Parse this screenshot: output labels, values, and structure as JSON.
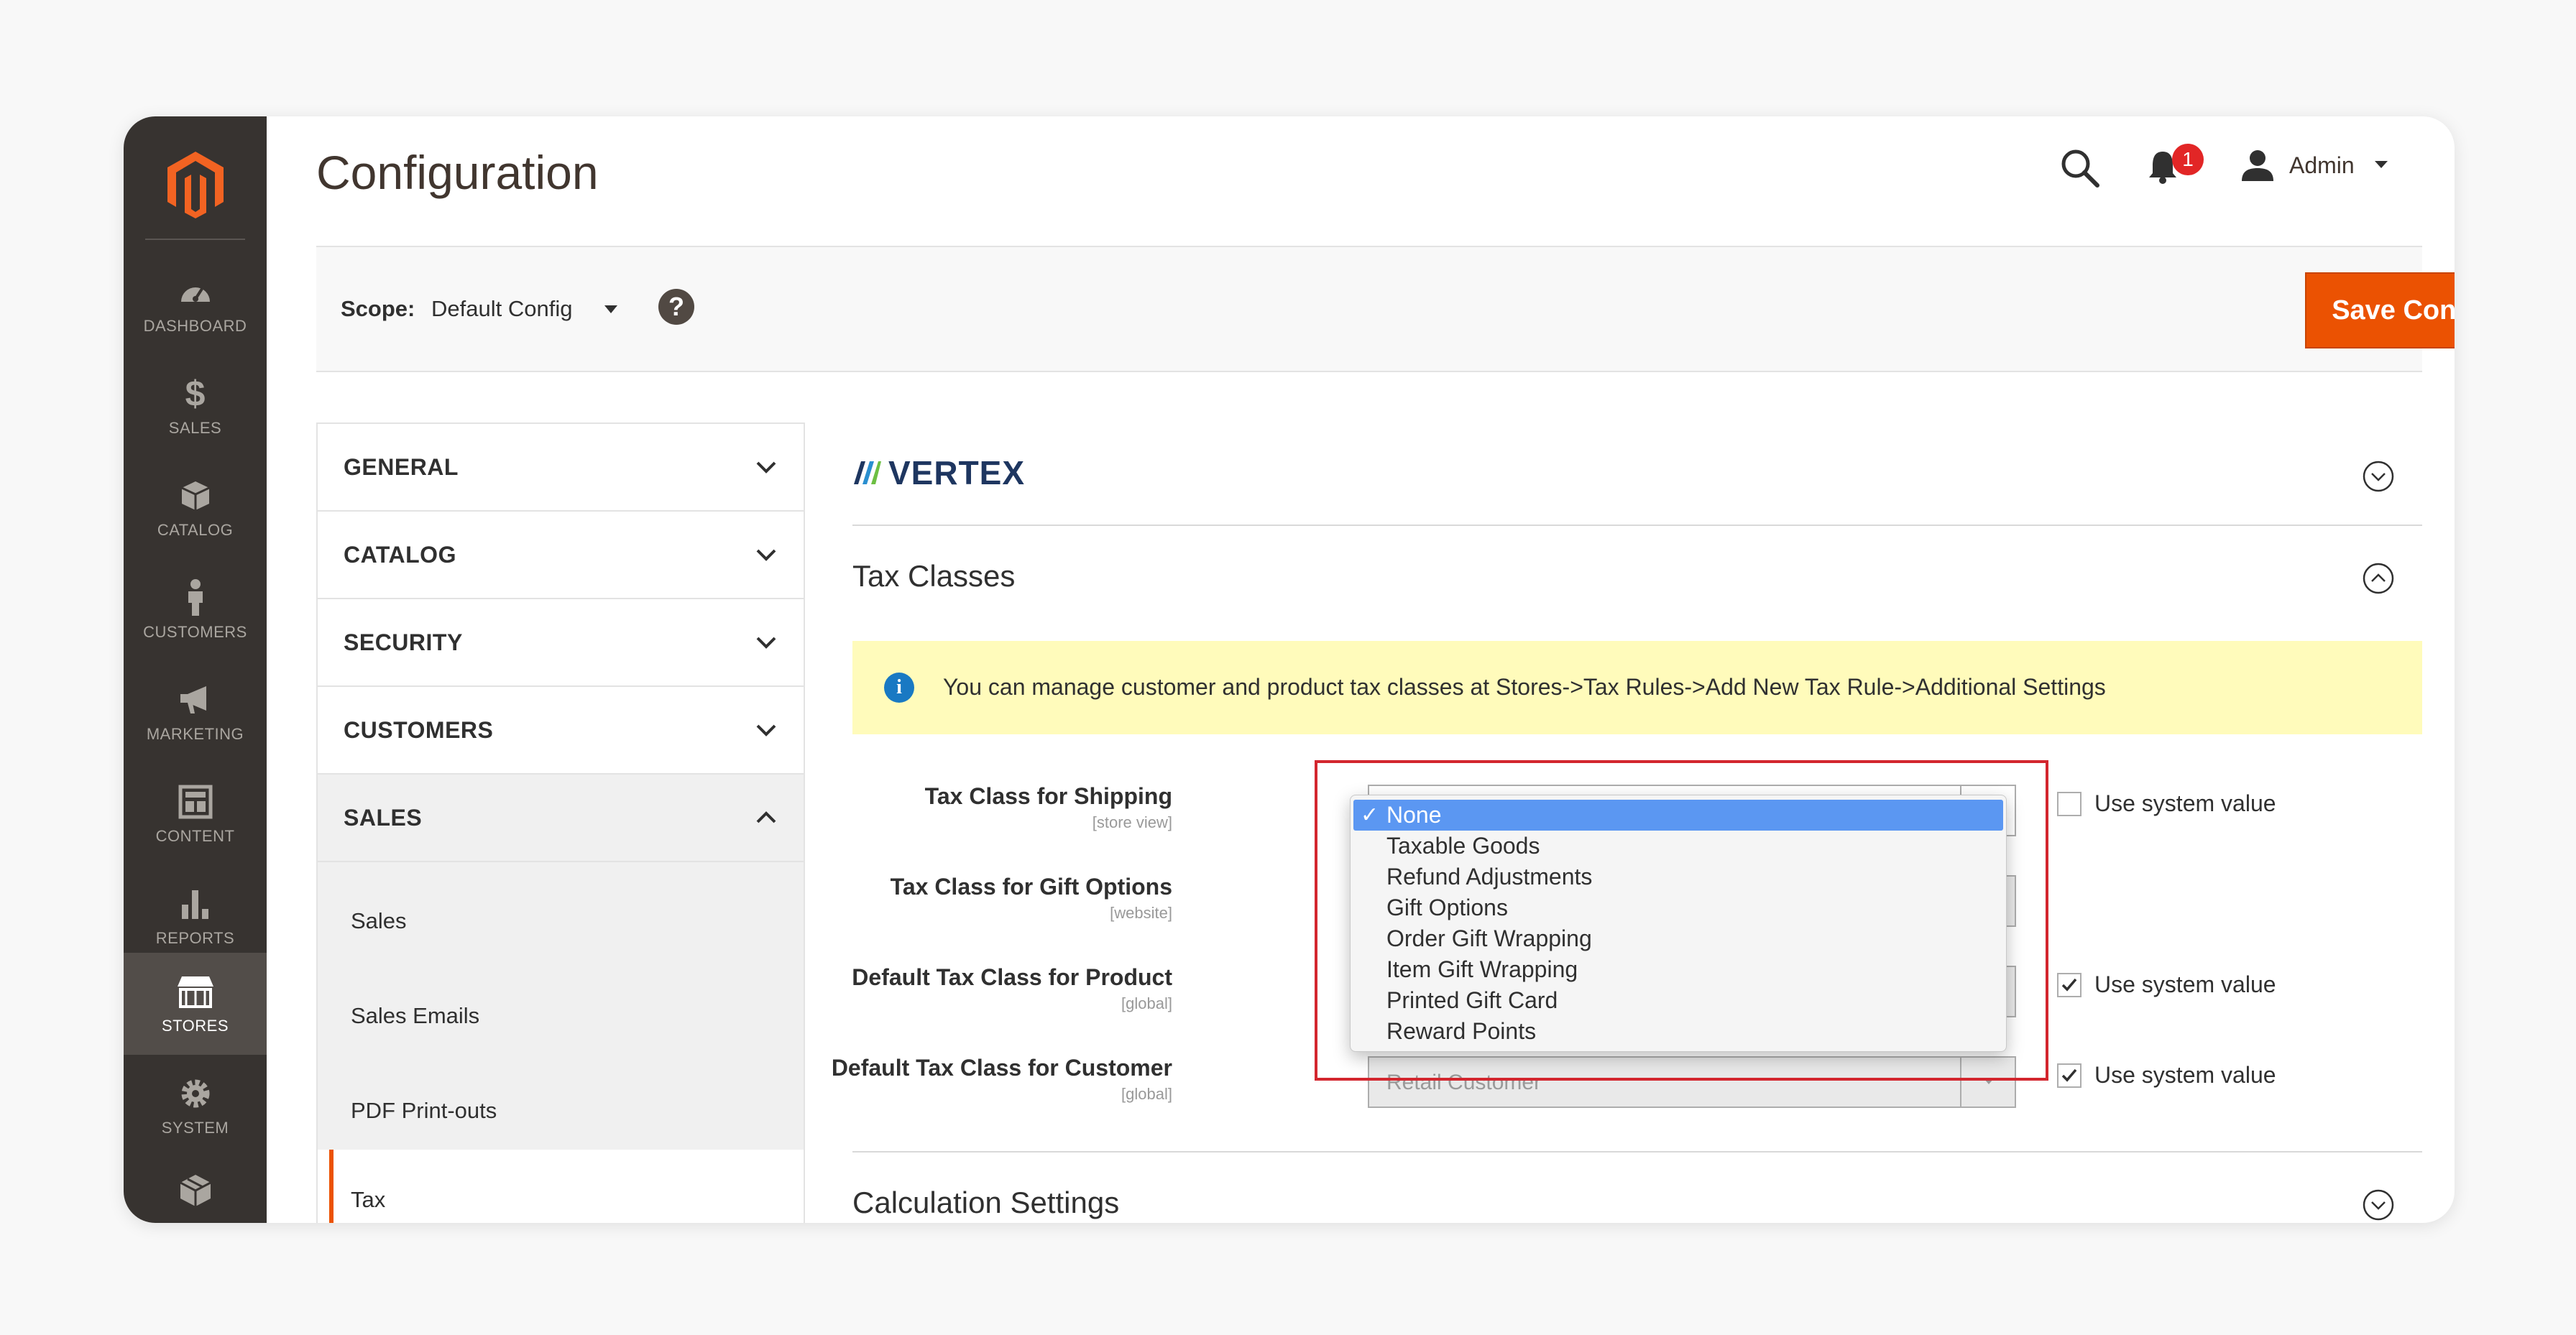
{
  "sidebar": {
    "items": [
      {
        "label": "DASHBOARD",
        "icon": "dashboard-icon"
      },
      {
        "label": "SALES",
        "icon": "dollar-icon"
      },
      {
        "label": "CATALOG",
        "icon": "box-icon"
      },
      {
        "label": "CUSTOMERS",
        "icon": "person-icon"
      },
      {
        "label": "MARKETING",
        "icon": "megaphone-icon"
      },
      {
        "label": "CONTENT",
        "icon": "layout-icon"
      },
      {
        "label": "REPORTS",
        "icon": "bar-chart-icon"
      },
      {
        "label": "STORES",
        "icon": "store-icon"
      },
      {
        "label": "SYSTEM",
        "icon": "gear-icon"
      }
    ]
  },
  "header": {
    "title": "Configuration",
    "notification_count": "1",
    "user_name": "Admin"
  },
  "scope": {
    "label": "Scope:",
    "value": "Default Config",
    "help": "?",
    "save_label": "Save Config"
  },
  "config_nav": {
    "sections": [
      {
        "label": "GENERAL"
      },
      {
        "label": "CATALOG"
      },
      {
        "label": "SECURITY"
      },
      {
        "label": "CUSTOMERS"
      },
      {
        "label": "SALES"
      }
    ],
    "sales_sub": [
      "Sales",
      "Sales Emails",
      "PDF Print-outs",
      "Tax"
    ]
  },
  "main": {
    "vertex_label": "VERTEX",
    "tax_classes_title": "Tax Classes",
    "notice": "You can manage customer and product tax classes at Stores->Tax Rules->Add New Tax Rule->Additional Settings",
    "fields": [
      {
        "label": "Tax Class for Shipping",
        "scope": "[store view]"
      },
      {
        "label": "Tax Class for Gift Options",
        "scope": "[website]"
      },
      {
        "label": "Default Tax Class for Product",
        "scope": "[global]"
      },
      {
        "label": "Default Tax Class for Customer",
        "scope": "[global]",
        "value": "Retail Customer"
      }
    ],
    "use_system_value": "Use system value",
    "calculation_title": "Calculation Settings"
  },
  "dropdown": {
    "options": [
      "None",
      "Taxable Goods",
      "Refund Adjustments",
      "Gift Options",
      "Order Gift Wrapping",
      "Item Gift Wrapping",
      "Printed Gift Card",
      "Reward Points"
    ],
    "selected": "None"
  },
  "colors": {
    "accent": "#eb5202",
    "sidebar_bg": "#373330",
    "highlight": "#d3262e",
    "selection": "#5b97f2"
  }
}
